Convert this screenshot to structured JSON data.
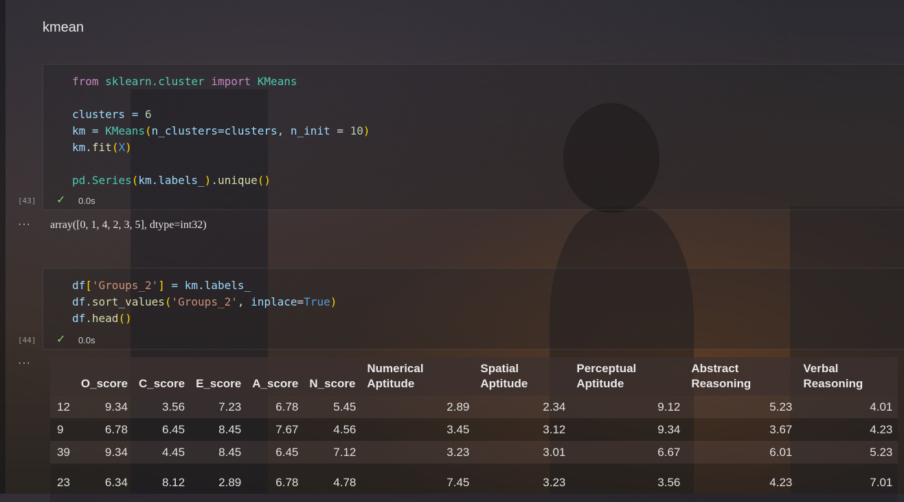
{
  "notebook": {
    "title": "kmean",
    "cells": [
      {
        "exec_count": "[43]",
        "time": "0.0s",
        "code": {
          "l1": {
            "kw1": "from",
            "mod": "sklearn.cluster",
            "kw2": "import",
            "cls": "KMeans"
          },
          "l2": {
            "a": "clusters = ",
            "b": "6"
          },
          "l3": {
            "a": "km = ",
            "cls": "KMeans",
            "p1": "(",
            "arg1": "n_clusters",
            "eq1": "=clusters, ",
            "arg2": "n_init",
            "eq2": " = ",
            "num": "10",
            "p2": ")"
          },
          "l4": {
            "a": "km.",
            "fn": "fit",
            "p1": "(",
            "v": "X",
            "p2": ")"
          },
          "l5": {
            "a": "pd.",
            "cls": "Series",
            "p1": "(",
            "b": "km.labels_",
            "p2": ")",
            "c": ".",
            "fn": "unique",
            "p3": "()"
          }
        },
        "output": "array([0, 1, 4, 2, 3, 5], dtype=int32)"
      },
      {
        "exec_count": "[44]",
        "time": "0.0s",
        "code": {
          "l1": {
            "a": "df",
            "p1": "[",
            "s": "'Groups_2'",
            "p2": "]",
            "b": " = km.labels_"
          },
          "l2": {
            "a": "df.",
            "fn": "sort_values",
            "p1": "(",
            "s": "'Groups_2'",
            "c": ", ",
            "kw": "inplace",
            "eq": "=",
            "bool": "True",
            "p2": ")"
          },
          "l3": {
            "a": "df.",
            "fn": "head",
            "p1": "()"
          }
        }
      }
    ],
    "dots": "···"
  },
  "table": {
    "headers": [
      "",
      "O_score",
      "C_score",
      "E_score",
      "A_score",
      "N_score",
      "Numerical Aptitude",
      "Spatial Aptitude",
      "Perceptual Aptitude",
      "Abstract Reasoning",
      "Verbal Reasoning"
    ],
    "rows": [
      [
        "12",
        "9.34",
        "3.56",
        "7.23",
        "6.78",
        "5.45",
        "2.89",
        "2.34",
        "9.12",
        "5.23",
        "4.01"
      ],
      [
        "9",
        "6.78",
        "6.45",
        "8.45",
        "7.67",
        "4.56",
        "3.45",
        "3.12",
        "9.34",
        "3.67",
        "4.23"
      ],
      [
        "39",
        "9.34",
        "4.45",
        "8.45",
        "6.45",
        "7.12",
        "3.23",
        "3.01",
        "6.67",
        "6.01",
        "5.23"
      ],
      [
        "23",
        "6.34",
        "8.12",
        "2.89",
        "6.78",
        "4.78",
        "7.45",
        "3.23",
        "3.56",
        "4.23",
        "7.01"
      ]
    ]
  },
  "icons": {
    "check": "check-icon",
    "dots": "more-icon"
  },
  "colors": {
    "check": "#89d185",
    "keyword": "#c586c0",
    "class": "#4ec9b0",
    "string": "#ce9178"
  }
}
